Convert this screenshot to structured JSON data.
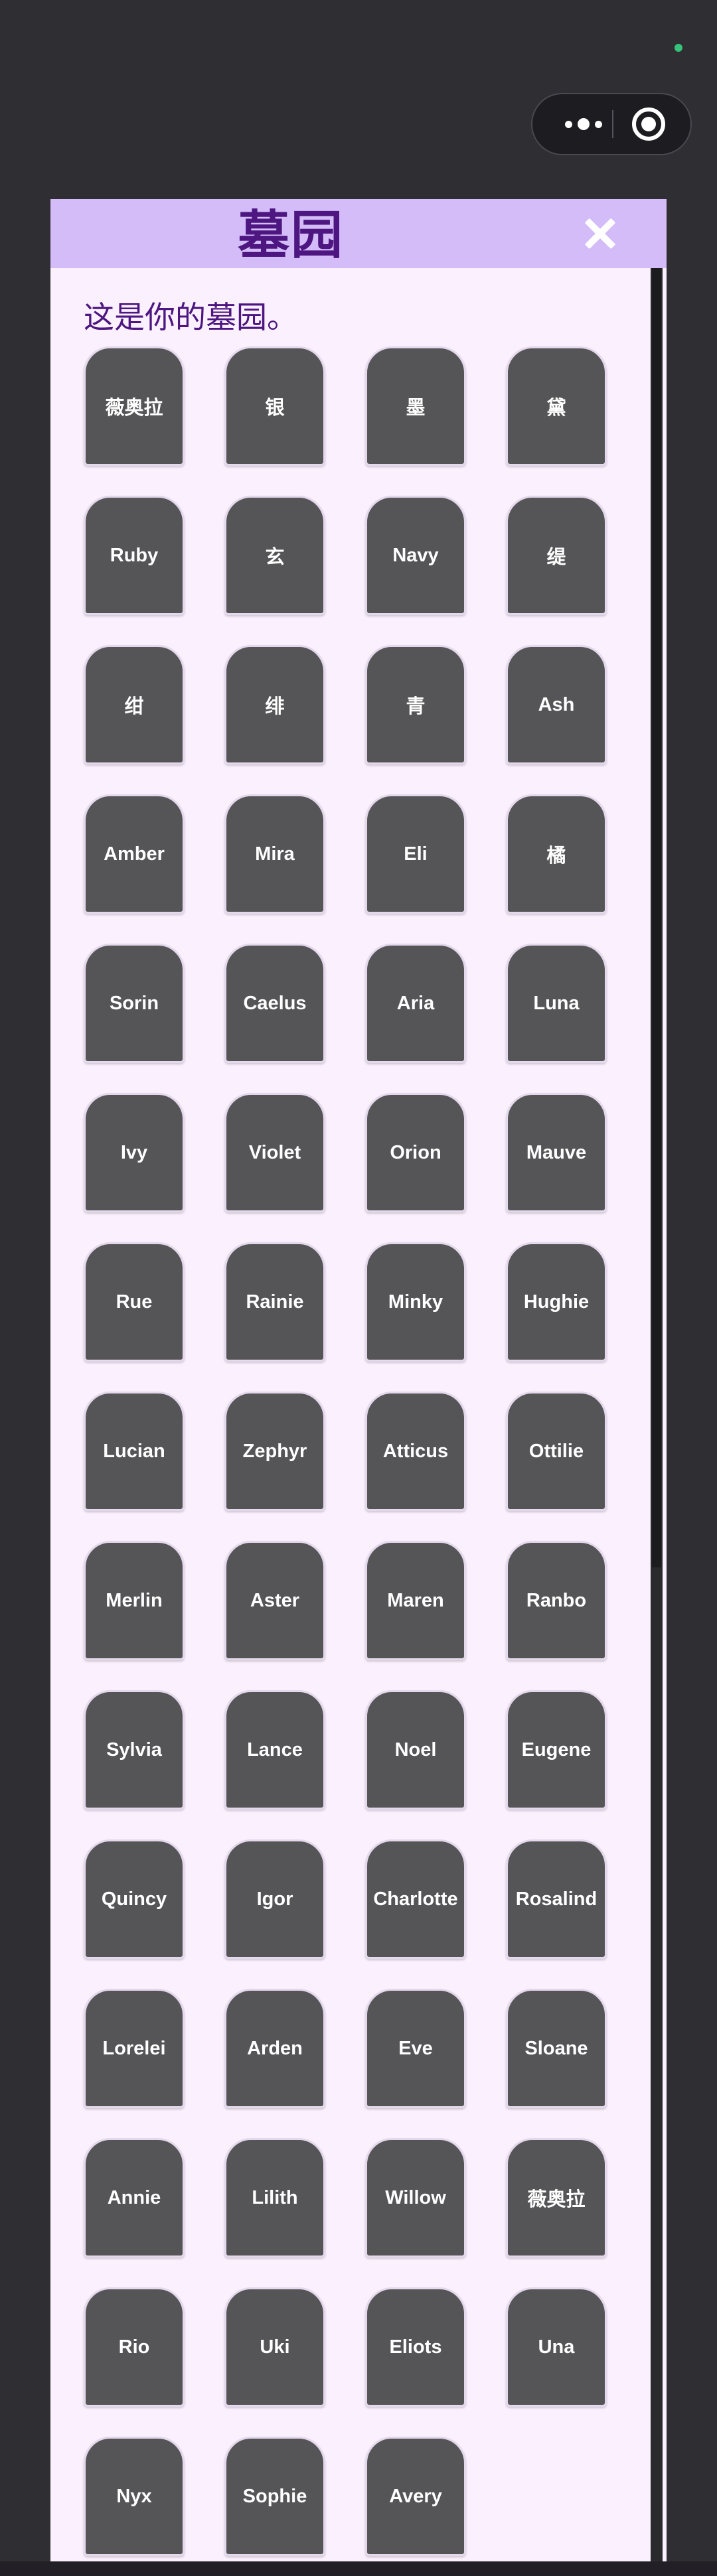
{
  "header": {
    "title": "墓园",
    "close_icon": "close-icon"
  },
  "intro_text": "这是你的墓园。",
  "tombstones": [
    {
      "name": "薇奥拉"
    },
    {
      "name": "银"
    },
    {
      "name": "墨"
    },
    {
      "name": "黛"
    },
    {
      "name": "Ruby"
    },
    {
      "name": "玄"
    },
    {
      "name": "Navy"
    },
    {
      "name": "缇"
    },
    {
      "name": "绀"
    },
    {
      "name": "绯"
    },
    {
      "name": "青"
    },
    {
      "name": "Ash"
    },
    {
      "name": "Amber"
    },
    {
      "name": "Mira"
    },
    {
      "name": "Eli"
    },
    {
      "name": "橘"
    },
    {
      "name": "Sorin"
    },
    {
      "name": "Caelus"
    },
    {
      "name": "Aria"
    },
    {
      "name": "Luna"
    },
    {
      "name": "Ivy"
    },
    {
      "name": "Violet"
    },
    {
      "name": "Orion"
    },
    {
      "name": "Mauve"
    },
    {
      "name": "Rue"
    },
    {
      "name": "Rainie"
    },
    {
      "name": "Minky"
    },
    {
      "name": "Hughie"
    },
    {
      "name": "Lucian"
    },
    {
      "name": "Zephyr"
    },
    {
      "name": "Atticus"
    },
    {
      "name": "Ottilie"
    },
    {
      "name": "Merlin"
    },
    {
      "name": "Aster"
    },
    {
      "name": "Maren"
    },
    {
      "name": "Ranbo"
    },
    {
      "name": "Sylvia"
    },
    {
      "name": "Lance"
    },
    {
      "name": "Noel"
    },
    {
      "name": "Eugene"
    },
    {
      "name": "Quincy"
    },
    {
      "name": "Igor"
    },
    {
      "name": "Charlotte"
    },
    {
      "name": "Rosalind"
    },
    {
      "name": "Lorelei"
    },
    {
      "name": "Arden"
    },
    {
      "name": "Eve"
    },
    {
      "name": "Sloane"
    },
    {
      "name": "Annie"
    },
    {
      "name": "Lilith"
    },
    {
      "name": "Willow"
    },
    {
      "name": "薇奥拉"
    },
    {
      "name": "Rio"
    },
    {
      "name": "Uki"
    },
    {
      "name": "Eliots"
    },
    {
      "name": "Una"
    },
    {
      "name": "Nyx"
    },
    {
      "name": "Sophie"
    },
    {
      "name": "Avery"
    }
  ],
  "colors": {
    "background": "#2f2e32",
    "panel_background": "#fbf1fe",
    "header_background": "#d3bcf7",
    "title_color": "#4d1681",
    "tombstone_fill": "#555456",
    "tombstone_text": "#ffffff",
    "status_dot": "#35c27a"
  }
}
